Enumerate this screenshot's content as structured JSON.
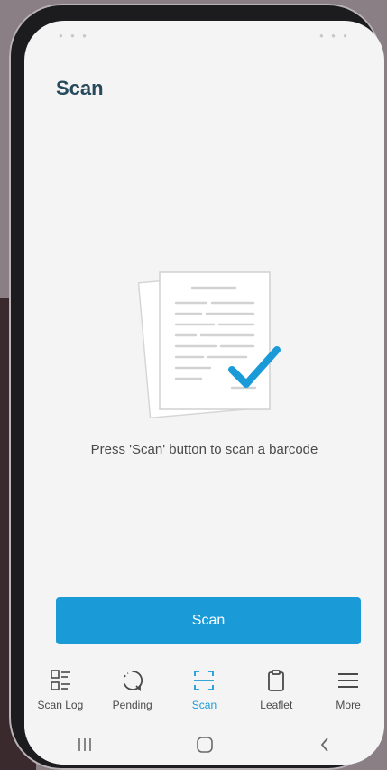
{
  "header": {
    "title": "Scan"
  },
  "empty_state": {
    "message": "Press 'Scan' button to scan a barcode"
  },
  "actions": {
    "scan_label": "Scan"
  },
  "tabs": [
    {
      "label": "Scan Log",
      "icon": "scan-log-icon",
      "active": false
    },
    {
      "label": "Pending",
      "icon": "pending-icon",
      "active": false
    },
    {
      "label": "Scan",
      "icon": "scan-icon",
      "active": true
    },
    {
      "label": "Leaflet",
      "icon": "clipboard-icon",
      "active": false
    },
    {
      "label": "More",
      "icon": "menu-icon",
      "active": false
    }
  ],
  "system_nav": [
    "recent-apps-icon",
    "home-icon",
    "back-icon"
  ],
  "colors": {
    "accent": "#1a9bd8",
    "title": "#264a5c",
    "background": "#f4f4f4"
  }
}
